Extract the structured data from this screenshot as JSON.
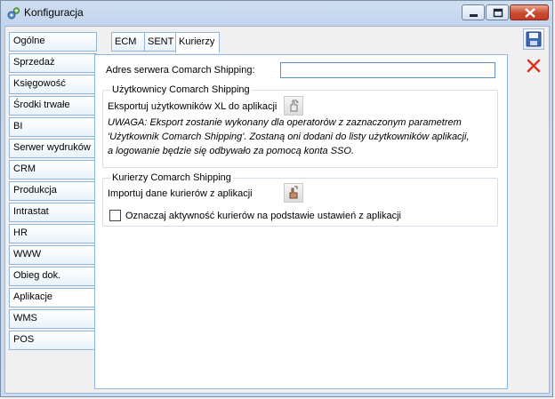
{
  "window": {
    "title": "Konfiguracja",
    "colors": {
      "titlebar": "#c9dbf0",
      "close_button": "#c84a31",
      "accent_border": "#8fb5d8"
    }
  },
  "sidebar": {
    "items": [
      {
        "label": "Ogólne"
      },
      {
        "label": "Sprzedaż"
      },
      {
        "label": "Księgowość"
      },
      {
        "label": "Środki trwałe"
      },
      {
        "label": "BI"
      },
      {
        "label": "Serwer wydruków"
      },
      {
        "label": "CRM"
      },
      {
        "label": "Produkcja"
      },
      {
        "label": "Intrastat"
      },
      {
        "label": "HR"
      },
      {
        "label": "WWW"
      },
      {
        "label": "Obieg dok."
      },
      {
        "label": "Aplikacje",
        "active": true
      },
      {
        "label": "WMS"
      },
      {
        "label": "POS"
      }
    ]
  },
  "tabs": [
    {
      "label": "ECM"
    },
    {
      "label": "SENT"
    },
    {
      "label": "Kurierzy",
      "active": true
    }
  ],
  "form": {
    "address_label": "Adres serwera Comarch Shipping:",
    "address_value": "",
    "users_group": {
      "title": "Użytkownicy Comarch Shipping",
      "export_label": "Eksportuj użytkowników XL do aplikacji",
      "export_icon": "export-hand-icon",
      "note_lines": [
        "UWAGA: Eksport zostanie wykonany dla operatorów z zaznaczonym parametrem",
        "'Użytkownik Comarch Shipping'. Zostaną oni dodani do listy użytkowników aplikacji,",
        "a logowanie będzie się odbywało za pomocą konta SSO."
      ]
    },
    "couriers_group": {
      "title": "Kurierzy Comarch Shipping",
      "import_label": "Importuj dane kurierów z aplikacji",
      "import_icon": "import-hand-icon",
      "checkbox_label": "Oznaczaj aktywność kurierów na podstawie ustawień z aplikacji",
      "checkbox_checked": false
    }
  },
  "toolbar": {
    "save_icon": "save-icon",
    "cancel_icon": "cancel-x-icon"
  }
}
